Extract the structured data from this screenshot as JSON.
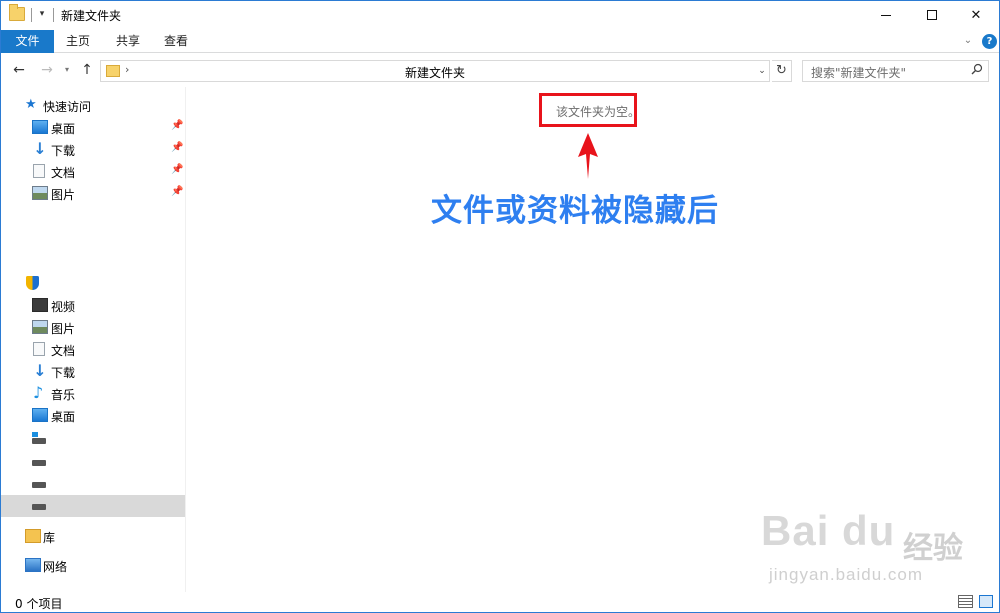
{
  "window": {
    "title": "新建文件夹",
    "quick_access_arrow": "▾"
  },
  "window_controls": {
    "close": "✕"
  },
  "ribbon": {
    "tabs": [
      {
        "label": "文件"
      },
      {
        "label": "主页"
      },
      {
        "label": "共享"
      },
      {
        "label": "查看"
      }
    ],
    "collapse_chevron": "⌄",
    "help": "?"
  },
  "address_bar": {
    "back": "←",
    "forward": "→",
    "recent": "▾",
    "up": "↑",
    "separator": "›",
    "path": "新建文件夹",
    "dropdown": "⌄",
    "refresh": "↻",
    "search_placeholder": "搜索\"新建文件夹\""
  },
  "sidebar": {
    "quick_access": {
      "label": "快速访问",
      "icon": "star-icon"
    },
    "pinned": [
      {
        "label": "桌面",
        "icon": "desktop-icon"
      },
      {
        "label": "下载",
        "icon": "download-icon"
      },
      {
        "label": "文档",
        "icon": "document-icon"
      },
      {
        "label": "图片",
        "icon": "pictures-icon"
      }
    ],
    "pin_glyph": "📌",
    "this_pc": [
      {
        "label": "视频",
        "icon": "video-icon"
      },
      {
        "label": "图片",
        "icon": "pictures-icon"
      },
      {
        "label": "文档",
        "icon": "document-icon"
      },
      {
        "label": "下载",
        "icon": "download-icon"
      },
      {
        "label": "音乐",
        "icon": "music-icon"
      },
      {
        "label": "桌面",
        "icon": "desktop-icon"
      }
    ],
    "library": {
      "label": "库",
      "icon": "library-icon"
    },
    "network": {
      "label": "网络",
      "icon": "network-icon"
    }
  },
  "content": {
    "empty_message": "该文件夹为空。",
    "annotation": "文件或资料被隐藏后",
    "highlight_color": "#e8131b",
    "annotation_color": "#2e7ff0"
  },
  "watermark": {
    "logo": "Bai du",
    "brand_cn": "经验",
    "url": "jingyan.baidu.com"
  },
  "status_bar": {
    "item_count": "0 个项目"
  }
}
